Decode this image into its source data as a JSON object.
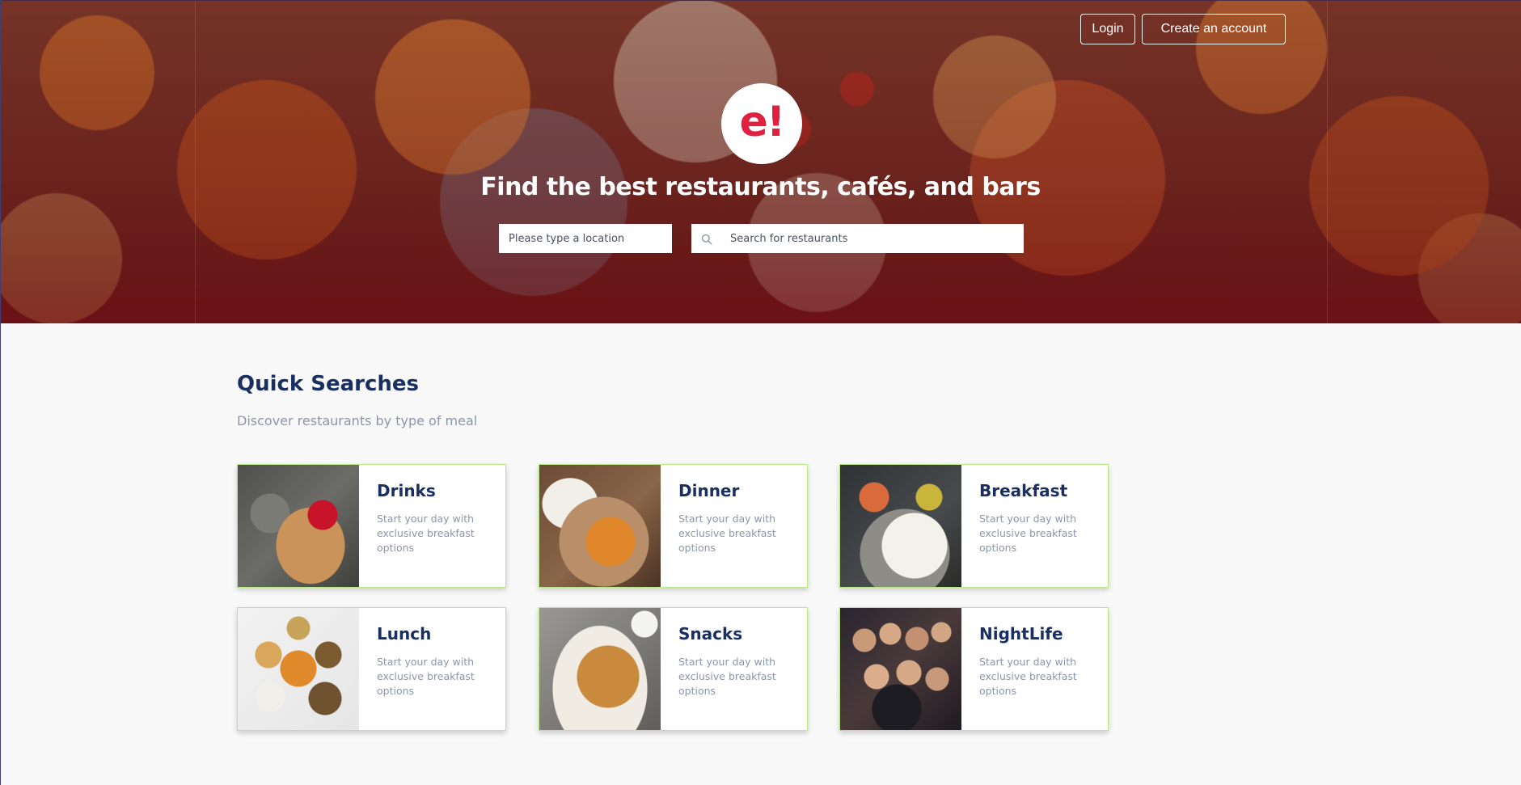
{
  "header": {
    "login_label": "Login",
    "signup_label": "Create an account"
  },
  "hero": {
    "logo_text": "e!",
    "title": "Find the best restaurants, cafés, and bars",
    "location_placeholder": "Please type a location",
    "search_placeholder": "Search for restaurants",
    "search_icon": "search-icon"
  },
  "quick_searches": {
    "title": "Quick Searches",
    "subtitle": "Discover restaurants by type of meal",
    "cards": [
      {
        "title": "Drinks",
        "description": "Start your day with exclusive breakfast options"
      },
      {
        "title": "Dinner",
        "description": "Start your day with exclusive breakfast options"
      },
      {
        "title": "Breakfast",
        "description": "Start your day with exclusive breakfast options"
      },
      {
        "title": "Lunch",
        "description": "Start your day with exclusive breakfast options"
      },
      {
        "title": "Snacks",
        "description": "Start your day with exclusive breakfast options"
      },
      {
        "title": "NightLife",
        "description": "Start your day with exclusive breakfast options"
      }
    ]
  },
  "colors": {
    "brand_red": "#e0203f",
    "heading_navy": "#192f60",
    "muted_text": "#8c96ab",
    "card_border": "#b8e986",
    "page_bg": "#f8f8f8"
  }
}
